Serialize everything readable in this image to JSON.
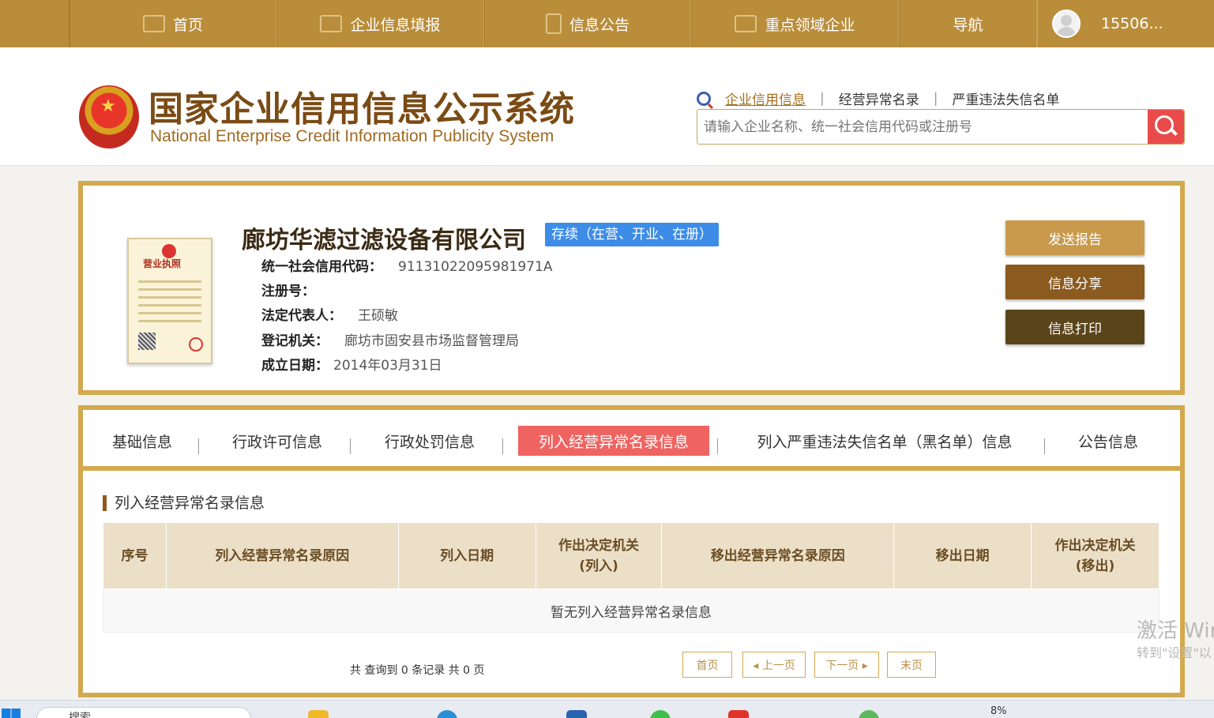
{
  "topnav": {
    "items": [
      {
        "label": "首页",
        "icon": "monitor-icon"
      },
      {
        "label": "企业信息填报",
        "icon": "edit-icon"
      },
      {
        "label": "信息公告",
        "icon": "document-icon"
      },
      {
        "label": "重点领域企业",
        "icon": "megaphone-icon"
      },
      {
        "label": "导航",
        "icon": ""
      }
    ],
    "user": "15506..."
  },
  "header": {
    "title": "国家企业信用信息公示系统",
    "subtitle": "National Enterprise Credit Information Publicity System",
    "search_links": [
      "企业信用信息",
      "经营异常名录",
      "严重违法失信名单"
    ],
    "search_separator": "|",
    "search_placeholder": "请输入企业名称、统一社会信用代码或注册号"
  },
  "license_image": {
    "title": "营业执照"
  },
  "company": {
    "name": "廊坊华滤过滤设备有限公司",
    "status": "存续（在营、开业、在册）",
    "fields": [
      {
        "key": "统一社会信用代码：",
        "value": "91131022095981971A"
      },
      {
        "key": "注册号：",
        "value": ""
      },
      {
        "key": "法定代表人：",
        "value": "王硕敏"
      },
      {
        "key": "登记机关：",
        "value": "廊坊市固安县市场监督管理局"
      },
      {
        "key": "成立日期：",
        "value": "2014年03月31日"
      }
    ],
    "actions": [
      "发送报告",
      "信息分享",
      "信息打印"
    ]
  },
  "tabs": [
    "基础信息",
    "行政许可信息",
    "行政处罚信息",
    "列入经营异常名录信息",
    "列入严重违法失信名单（黑名单）信息",
    "公告信息"
  ],
  "section": {
    "title": "列入经营异常名录信息",
    "columns": [
      "序号",
      "列入经营异常名录原因",
      "列入日期",
      "作出决定机关\n(列入)",
      "移出经营异常名录原因",
      "移出日期",
      "作出决定机关\n(移出)"
    ],
    "empty_text": "暂无列入经营异常名录信息",
    "summary": "共 查询到 0 条记录 共 0 页",
    "pager": [
      "首页",
      "◂ 上一页",
      "下一页 ▸",
      "末页"
    ]
  },
  "watermark": {
    "line1": "激活 Wir",
    "line2": "转到\"设置\"以"
  },
  "taskbar": {
    "search": "搜索",
    "percent": "8%"
  },
  "colors": {
    "nav_bg": "#b98d3a",
    "card_border": "#d3a94f",
    "active_tab": "#ef6461",
    "status_badge": "#3d8de8",
    "btn_send": "#c99a4c",
    "btn_share": "#8a5a1f",
    "btn_print": "#5a4419"
  }
}
